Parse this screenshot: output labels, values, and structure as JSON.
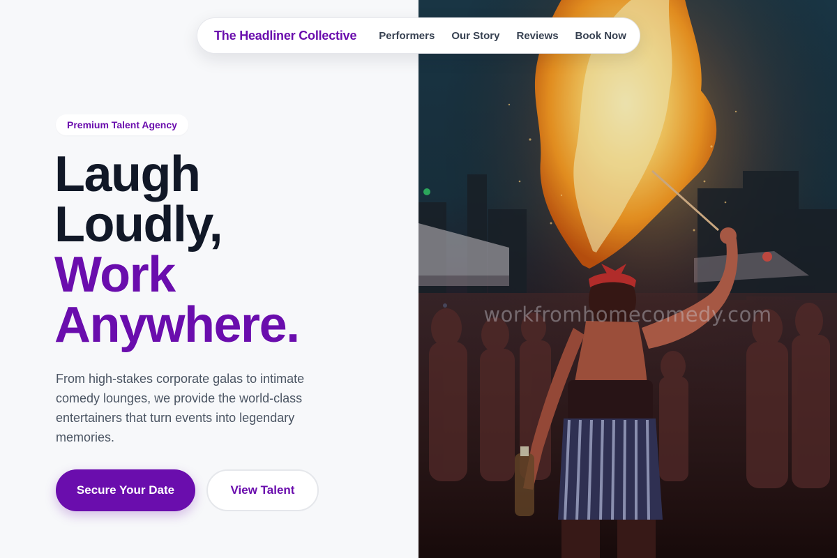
{
  "nav": {
    "brand": "The Headliner Collective",
    "links": [
      "Performers",
      "Our Story",
      "Reviews",
      "Book Now"
    ]
  },
  "hero": {
    "badge": "Premium Talent Agency",
    "headline": {
      "line1": "Laugh",
      "line2": "Loudly,",
      "line3": "Work",
      "line4": "Anywhere."
    },
    "description": "From high-stakes corporate galas to intimate comedy lounges, we provide the world-class entertainers that turn events into legendary memories.",
    "primary_cta": "Secure Your Date",
    "secondary_cta": "View Talent",
    "image_watermark": "workfromhomecomedy.com",
    "image_subject": "fire breather performing at a night event"
  },
  "colors": {
    "accent": "#6a0dad",
    "heading": "#111827",
    "body_text": "#4b5563",
    "page_background": "#f7f8fa"
  }
}
